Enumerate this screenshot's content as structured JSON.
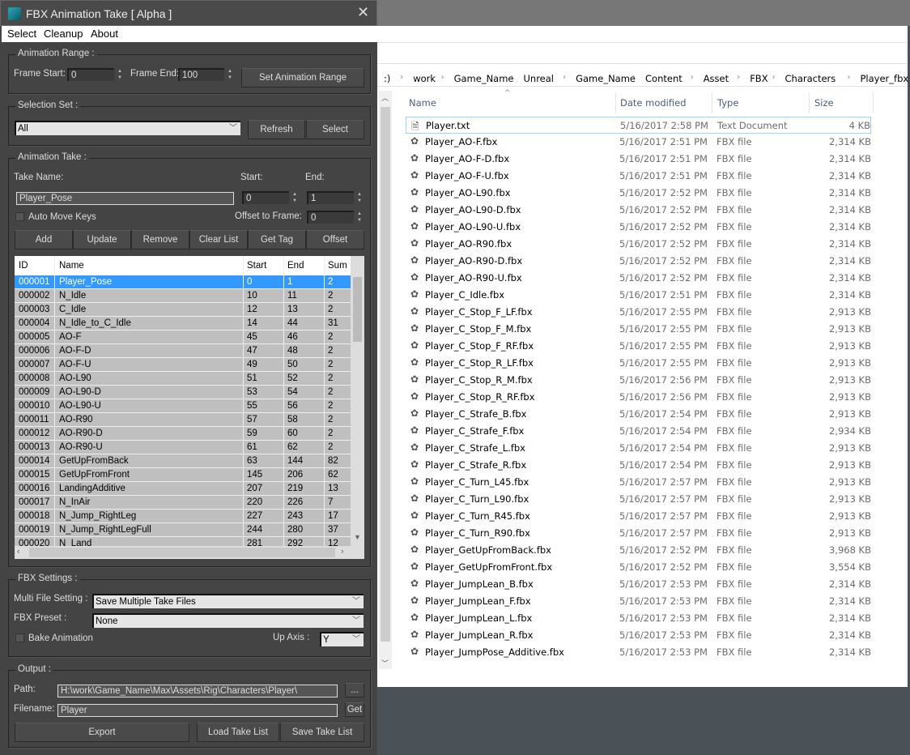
{
  "dialog": {
    "title": "FBX Animation Take [ Alpha ]",
    "menu": [
      "Select",
      "Cleanup",
      "About"
    ],
    "animation_range": {
      "label": "Animation Range :",
      "frame_start_label": "Frame Start:",
      "frame_start": "0",
      "frame_end_label": "Frame End:",
      "frame_end": "100",
      "set_button": "Set Animation Range"
    },
    "selection_set": {
      "label": "Selection Set :",
      "value": "All",
      "refresh": "Refresh",
      "select": "Select"
    },
    "animation_take": {
      "label": "Animation Take :",
      "take_name_label": "Take Name:",
      "start_label": "Start:",
      "end_label": "End:",
      "take_name": "Player_Pose",
      "start": "0",
      "end": "1",
      "auto_move_keys": "Auto Move Keys",
      "auto_move_checked": false,
      "offset_label": "Offset to Frame:",
      "offset": "0",
      "buttons": [
        "Add",
        "Update",
        "Remove",
        "Clear List",
        "Get Tag",
        "Offset"
      ]
    },
    "table": {
      "columns": [
        "ID",
        "Name",
        "Start",
        "End",
        "Sum"
      ],
      "selected_index": 0,
      "rows": [
        [
          "000001",
          "Player_Pose",
          "0",
          "1",
          "2"
        ],
        [
          "000002",
          "N_Idle",
          "10",
          "11",
          "2"
        ],
        [
          "000003",
          "C_Idle",
          "12",
          "13",
          "2"
        ],
        [
          "000004",
          "N_Idle_to_C_Idle",
          "14",
          "44",
          "31"
        ],
        [
          "000005",
          "AO-F",
          "45",
          "46",
          "2"
        ],
        [
          "000006",
          "AO-F-D",
          "47",
          "48",
          "2"
        ],
        [
          "000007",
          "AO-F-U",
          "49",
          "50",
          "2"
        ],
        [
          "000008",
          "AO-L90",
          "51",
          "52",
          "2"
        ],
        [
          "000009",
          "AO-L90-D",
          "53",
          "54",
          "2"
        ],
        [
          "000010",
          "AO-L90-U",
          "55",
          "56",
          "2"
        ],
        [
          "000011",
          "AO-R90",
          "57",
          "58",
          "2"
        ],
        [
          "000012",
          "AO-R90-D",
          "59",
          "60",
          "2"
        ],
        [
          "000013",
          "AO-R90-U",
          "61",
          "62",
          "2"
        ],
        [
          "000014",
          "GetUpFromBack",
          "63",
          "144",
          "82"
        ],
        [
          "000015",
          "GetUpFromFront",
          "145",
          "206",
          "62"
        ],
        [
          "000016",
          "LandingAdditive",
          "207",
          "219",
          "13"
        ],
        [
          "000017",
          "N_InAir",
          "220",
          "226",
          "7"
        ],
        [
          "000018",
          "N_Jump_RightLeg",
          "227",
          "243",
          "17"
        ],
        [
          "000019",
          "N_Jump_RightLegFull",
          "244",
          "280",
          "37"
        ],
        [
          "000020",
          "N_Land",
          "281",
          "292",
          "12"
        ]
      ]
    },
    "fbx_settings": {
      "label": "FBX Settings :",
      "multi_file_label": "Multi File Setting :",
      "multi_file": "Save Multiple Take Files",
      "preset_label": "FBX Preset :",
      "preset": "None",
      "bake_animation": "Bake Animation",
      "bake_checked": false,
      "up_axis_label": "Up Axis :",
      "up_axis": "Y"
    },
    "output": {
      "label": "Output :",
      "path_label": "Path:",
      "path": "H:\\work\\Game_Name\\Max\\Assets\\Rig\\Characters\\Player\\",
      "browse": "...",
      "filename_label": "Filename:",
      "filename": "Player",
      "get": "Get",
      "export": "Export",
      "load": "Load Take List",
      "save": "Save Take List"
    }
  },
  "explorer": {
    "breadcrumb": [
      ":)",
      "work",
      "Game_Name",
      "Unreal",
      "Game_Name",
      "Content",
      "Asset",
      "FBX",
      "Characters",
      "Player_fbx"
    ],
    "columns": [
      "Name",
      "Date modified",
      "Type",
      "Size"
    ],
    "files": [
      {
        "name": "Player.txt",
        "date": "5/16/2017 2:58 PM",
        "type": "Text Document",
        "size": "4 KB",
        "icon": "text-file-icon"
      },
      {
        "name": "Player_AO-F.fbx",
        "date": "5/16/2017 2:51 PM",
        "type": "FBX file",
        "size": "2,314 KB",
        "icon": "fbx-file-icon"
      },
      {
        "name": "Player_AO-F-D.fbx",
        "date": "5/16/2017 2:51 PM",
        "type": "FBX file",
        "size": "2,314 KB",
        "icon": "fbx-file-icon"
      },
      {
        "name": "Player_AO-F-U.fbx",
        "date": "5/16/2017 2:51 PM",
        "type": "FBX file",
        "size": "2,314 KB",
        "icon": "fbx-file-icon"
      },
      {
        "name": "Player_AO-L90.fbx",
        "date": "5/16/2017 2:52 PM",
        "type": "FBX file",
        "size": "2,314 KB",
        "icon": "fbx-file-icon"
      },
      {
        "name": "Player_AO-L90-D.fbx",
        "date": "5/16/2017 2:52 PM",
        "type": "FBX file",
        "size": "2,314 KB",
        "icon": "fbx-file-icon"
      },
      {
        "name": "Player_AO-L90-U.fbx",
        "date": "5/16/2017 2:52 PM",
        "type": "FBX file",
        "size": "2,314 KB",
        "icon": "fbx-file-icon"
      },
      {
        "name": "Player_AO-R90.fbx",
        "date": "5/16/2017 2:52 PM",
        "type": "FBX file",
        "size": "2,314 KB",
        "icon": "fbx-file-icon"
      },
      {
        "name": "Player_AO-R90-D.fbx",
        "date": "5/16/2017 2:52 PM",
        "type": "FBX file",
        "size": "2,314 KB",
        "icon": "fbx-file-icon"
      },
      {
        "name": "Player_AO-R90-U.fbx",
        "date": "5/16/2017 2:52 PM",
        "type": "FBX file",
        "size": "2,314 KB",
        "icon": "fbx-file-icon"
      },
      {
        "name": "Player_C_Idle.fbx",
        "date": "5/16/2017 2:51 PM",
        "type": "FBX file",
        "size": "2,314 KB",
        "icon": "fbx-file-icon"
      },
      {
        "name": "Player_C_Stop_F_LF.fbx",
        "date": "5/16/2017 2:55 PM",
        "type": "FBX file",
        "size": "2,913 KB",
        "icon": "fbx-file-icon"
      },
      {
        "name": "Player_C_Stop_F_M.fbx",
        "date": "5/16/2017 2:55 PM",
        "type": "FBX file",
        "size": "2,913 KB",
        "icon": "fbx-file-icon"
      },
      {
        "name": "Player_C_Stop_F_RF.fbx",
        "date": "5/16/2017 2:55 PM",
        "type": "FBX file",
        "size": "2,913 KB",
        "icon": "fbx-file-icon"
      },
      {
        "name": "Player_C_Stop_R_LF.fbx",
        "date": "5/16/2017 2:55 PM",
        "type": "FBX file",
        "size": "2,913 KB",
        "icon": "fbx-file-icon"
      },
      {
        "name": "Player_C_Stop_R_M.fbx",
        "date": "5/16/2017 2:56 PM",
        "type": "FBX file",
        "size": "2,913 KB",
        "icon": "fbx-file-icon"
      },
      {
        "name": "Player_C_Stop_R_RF.fbx",
        "date": "5/16/2017 2:56 PM",
        "type": "FBX file",
        "size": "2,913 KB",
        "icon": "fbx-file-icon"
      },
      {
        "name": "Player_C_Strafe_B.fbx",
        "date": "5/16/2017 2:54 PM",
        "type": "FBX file",
        "size": "2,913 KB",
        "icon": "fbx-file-icon"
      },
      {
        "name": "Player_C_Strafe_F.fbx",
        "date": "5/16/2017 2:54 PM",
        "type": "FBX file",
        "size": "2,934 KB",
        "icon": "fbx-file-icon"
      },
      {
        "name": "Player_C_Strafe_L.fbx",
        "date": "5/16/2017 2:54 PM",
        "type": "FBX file",
        "size": "2,913 KB",
        "icon": "fbx-file-icon"
      },
      {
        "name": "Player_C_Strafe_R.fbx",
        "date": "5/16/2017 2:54 PM",
        "type": "FBX file",
        "size": "2,913 KB",
        "icon": "fbx-file-icon"
      },
      {
        "name": "Player_C_Turn_L45.fbx",
        "date": "5/16/2017 2:57 PM",
        "type": "FBX file",
        "size": "2,913 KB",
        "icon": "fbx-file-icon"
      },
      {
        "name": "Player_C_Turn_L90.fbx",
        "date": "5/16/2017 2:57 PM",
        "type": "FBX file",
        "size": "2,913 KB",
        "icon": "fbx-file-icon"
      },
      {
        "name": "Player_C_Turn_R45.fbx",
        "date": "5/16/2017 2:57 PM",
        "type": "FBX file",
        "size": "2,913 KB",
        "icon": "fbx-file-icon"
      },
      {
        "name": "Player_C_Turn_R90.fbx",
        "date": "5/16/2017 2:57 PM",
        "type": "FBX file",
        "size": "2,913 KB",
        "icon": "fbx-file-icon"
      },
      {
        "name": "Player_GetUpFromBack.fbx",
        "date": "5/16/2017 2:52 PM",
        "type": "FBX file",
        "size": "3,968 KB",
        "icon": "fbx-file-icon"
      },
      {
        "name": "Player_GetUpFromFront.fbx",
        "date": "5/16/2017 2:52 PM",
        "type": "FBX file",
        "size": "3,554 KB",
        "icon": "fbx-file-icon"
      },
      {
        "name": "Player_JumpLean_B.fbx",
        "date": "5/16/2017 2:53 PM",
        "type": "FBX file",
        "size": "2,314 KB",
        "icon": "fbx-file-icon"
      },
      {
        "name": "Player_JumpLean_F.fbx",
        "date": "5/16/2017 2:53 PM",
        "type": "FBX file",
        "size": "2,314 KB",
        "icon": "fbx-file-icon"
      },
      {
        "name": "Player_JumpLean_L.fbx",
        "date": "5/16/2017 2:53 PM",
        "type": "FBX file",
        "size": "2,314 KB",
        "icon": "fbx-file-icon"
      },
      {
        "name": "Player_JumpLean_R.fbx",
        "date": "5/16/2017 2:53 PM",
        "type": "FBX file",
        "size": "2,314 KB",
        "icon": "fbx-file-icon"
      },
      {
        "name": "Player_JumpPose_Additive.fbx",
        "date": "5/16/2017 2:53 PM",
        "type": "FBX file",
        "size": "2,314 KB",
        "icon": "fbx-file-icon"
      }
    ]
  }
}
